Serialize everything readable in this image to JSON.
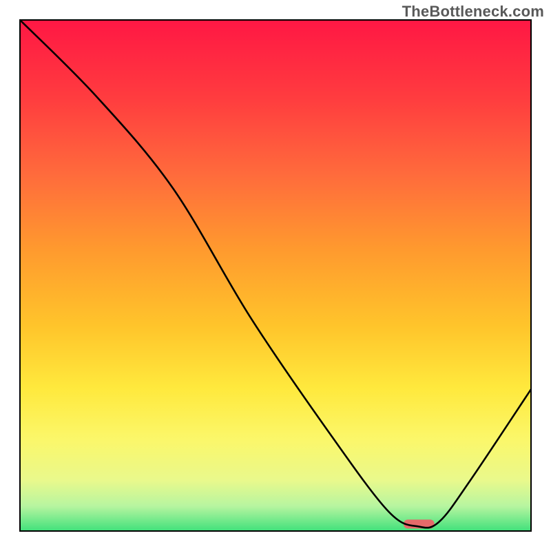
{
  "watermark": "TheBottleneck.com",
  "chart_data": {
    "type": "line",
    "title": "",
    "xlabel": "",
    "ylabel": "",
    "xlim": [
      0,
      100
    ],
    "ylim": [
      0,
      100
    ],
    "grid": false,
    "series": [
      {
        "name": "curve",
        "x": [
          0,
          15,
          30,
          45,
          60,
          72,
          78,
          82,
          88,
          100
        ],
        "values": [
          100,
          85,
          67,
          42,
          20,
          4,
          1,
          2,
          10,
          28
        ]
      }
    ],
    "marker": {
      "name": "highlight-segment",
      "x_start": 75,
      "x_end": 81,
      "y": 1.5,
      "color": "#e46a6a"
    },
    "background_gradient": {
      "stops": [
        {
          "offset": 0.0,
          "color": "#ff1744"
        },
        {
          "offset": 0.15,
          "color": "#ff3b3f"
        },
        {
          "offset": 0.3,
          "color": "#ff6a3c"
        },
        {
          "offset": 0.45,
          "color": "#ff9a2e"
        },
        {
          "offset": 0.6,
          "color": "#ffc52b"
        },
        {
          "offset": 0.72,
          "color": "#ffe93d"
        },
        {
          "offset": 0.82,
          "color": "#fbf76a"
        },
        {
          "offset": 0.9,
          "color": "#e9f98c"
        },
        {
          "offset": 0.95,
          "color": "#b7f5a0"
        },
        {
          "offset": 1.0,
          "color": "#3de07a"
        }
      ]
    },
    "frame_color": "#000000",
    "curve_color": "#000000",
    "curve_width": 2.6
  }
}
